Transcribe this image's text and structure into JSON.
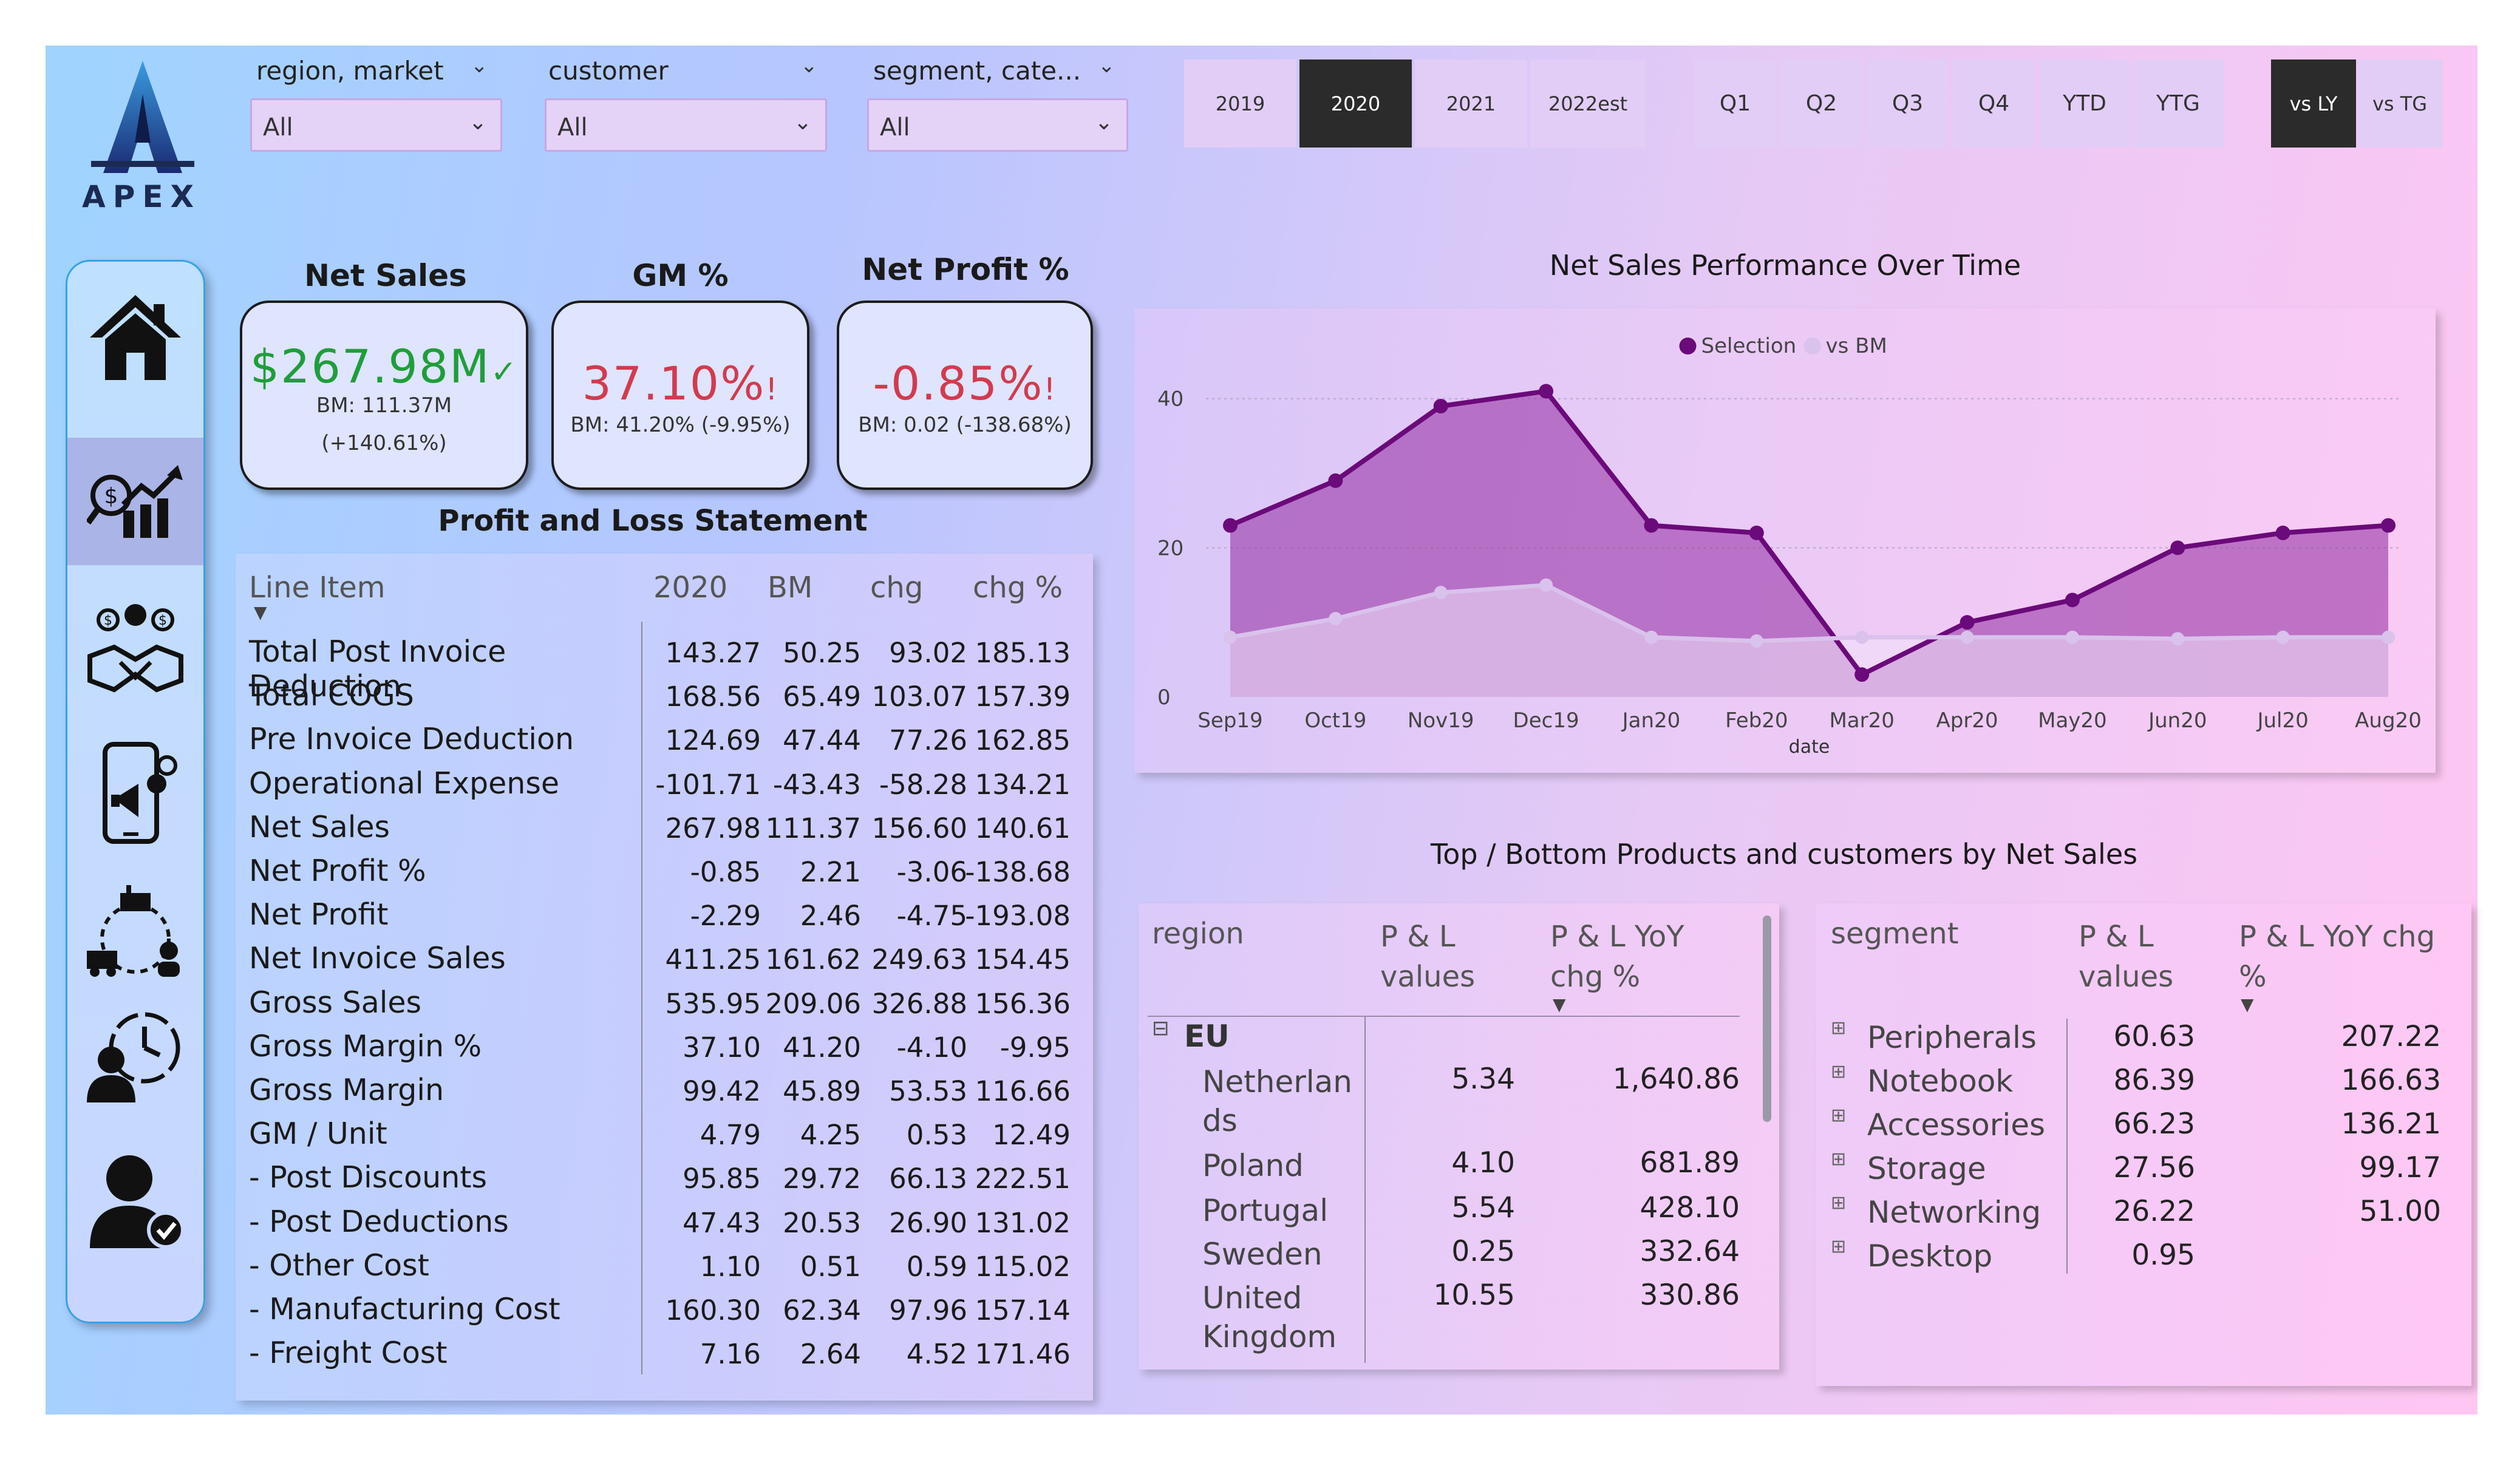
{
  "logo": {
    "text": "APEX"
  },
  "filters": [
    {
      "label": "region, market",
      "value": "All"
    },
    {
      "label": "customer",
      "value": "All"
    },
    {
      "label": "segment, cate...",
      "value": "All"
    }
  ],
  "years": [
    {
      "label": "2019",
      "active": false
    },
    {
      "label": "2020",
      "active": true
    },
    {
      "label": "2021",
      "active": false
    },
    {
      "label": "2022est",
      "active": false
    }
  ],
  "periods": [
    "Q1",
    "Q2",
    "Q3",
    "Q4",
    "YTD",
    "YTG"
  ],
  "compare": [
    {
      "label": "vs LY",
      "active": true
    },
    {
      "label": "vs TG",
      "active": false
    }
  ],
  "sidebar": {
    "items": [
      {
        "icon": "home-icon"
      },
      {
        "icon": "finance-chart-icon",
        "selected": true
      },
      {
        "icon": "sales-handshake-icon"
      },
      {
        "icon": "marketing-phone-icon"
      },
      {
        "icon": "supply-chain-icon"
      },
      {
        "icon": "time-person-icon"
      },
      {
        "icon": "user-check-icon"
      }
    ]
  },
  "kpis": {
    "net_sales": {
      "title": "Net Sales",
      "value": "$267.98M",
      "mark": "✓",
      "bm": "BM: 111.37M",
      "chg": "(+140.61%)",
      "color": "#1f9e3a"
    },
    "gm": {
      "title": "GM %",
      "value": "37.10%",
      "mark": "!",
      "bm": "BM: 41.20% (-9.95%)",
      "color": "#d23b4e"
    },
    "np": {
      "title": "Net Profit %",
      "value": "-0.85%",
      "mark": "!",
      "bm": "BM: 0.02 (-138.68%)",
      "color": "#d23b4e"
    }
  },
  "pl": {
    "title": "Profit and Loss Statement",
    "headers": [
      "Line Item",
      "2020",
      "BM",
      "chg",
      "chg %"
    ],
    "rows": [
      [
        "Total Post Invoice Deduction",
        "143.27",
        "50.25",
        "93.02",
        "185.13"
      ],
      [
        "Total COGS",
        "168.56",
        "65.49",
        "103.07",
        "157.39"
      ],
      [
        "Pre Invoice Deduction",
        "124.69",
        "47.44",
        "77.26",
        "162.85"
      ],
      [
        "Operational Expense",
        "-101.71",
        "-43.43",
        "-58.28",
        "134.21"
      ],
      [
        "Net Sales",
        "267.98",
        "111.37",
        "156.60",
        "140.61"
      ],
      [
        "Net Profit %",
        "-0.85",
        "2.21",
        "-3.06",
        "-138.68"
      ],
      [
        "Net Profit",
        "-2.29",
        "2.46",
        "-4.75",
        "-193.08"
      ],
      [
        "Net Invoice Sales",
        "411.25",
        "161.62",
        "249.63",
        "154.45"
      ],
      [
        "Gross Sales",
        "535.95",
        "209.06",
        "326.88",
        "156.36"
      ],
      [
        "Gross Margin %",
        "37.10",
        "41.20",
        "-4.10",
        "-9.95"
      ],
      [
        "Gross Margin",
        "99.42",
        "45.89",
        "53.53",
        "116.66"
      ],
      [
        "GM / Unit",
        "4.79",
        "4.25",
        "0.53",
        "12.49"
      ],
      [
        "- Post Discounts",
        "95.85",
        "29.72",
        "66.13",
        "222.51"
      ],
      [
        "- Post Deductions",
        "47.43",
        "20.53",
        "26.90",
        "131.02"
      ],
      [
        "- Other Cost",
        "1.10",
        "0.51",
        "0.59",
        "115.02"
      ],
      [
        "- Manufacturing Cost",
        "160.30",
        "62.34",
        "97.96",
        "157.14"
      ],
      [
        "- Freight Cost",
        "7.16",
        "2.64",
        "4.52",
        "171.46"
      ]
    ]
  },
  "chart_data": {
    "type": "area",
    "title": "Net Sales Performance Over Time",
    "xlabel": "date",
    "ylabel": "",
    "categories": [
      "Sep19",
      "Oct19",
      "Nov19",
      "Dec19",
      "Jan20",
      "Feb20",
      "Mar20",
      "Apr20",
      "May20",
      "Jun20",
      "Jul20",
      "Aug20"
    ],
    "series": [
      {
        "name": "Selection",
        "values": [
          23,
          29,
          39,
          41,
          23,
          22,
          3,
          10,
          13,
          20,
          22,
          23
        ],
        "color": "#6b0a7a"
      },
      {
        "name": "vs BM",
        "values": [
          8,
          10.5,
          14,
          15,
          8,
          7.5,
          8,
          8,
          8,
          7.8,
          8,
          8
        ],
        "color": "#d9c2ec"
      }
    ],
    "yticks": [
      "0",
      "20",
      "40"
    ],
    "ylim": [
      0,
      46
    ],
    "legend": "top-center"
  },
  "bottom": {
    "title": "Top / Bottom Products and customers by Net Sales",
    "region_table": {
      "headers": [
        "region",
        "P & L values",
        "P & L YoY chg %"
      ],
      "group": "EU",
      "rows": [
        [
          "Netherlan ds",
          "5.34",
          "1,640.86"
        ],
        [
          "Poland",
          "4.10",
          "681.89"
        ],
        [
          "Portugal",
          "5.54",
          "428.10"
        ],
        [
          "Sweden",
          "0.25",
          "332.64"
        ],
        [
          "United Kingdom",
          "10.55",
          "330.86"
        ]
      ]
    },
    "segment_table": {
      "headers": [
        "segment",
        "P & L values",
        "P & L YoY chg %"
      ],
      "rows": [
        [
          "Peripherals",
          "60.63",
          "207.22"
        ],
        [
          "Notebook",
          "86.39",
          "166.63"
        ],
        [
          "Accessories",
          "66.23",
          "136.21"
        ],
        [
          "Storage",
          "27.56",
          "99.17"
        ],
        [
          "Networking",
          "26.22",
          "51.00"
        ],
        [
          "Desktop",
          "0.95",
          ""
        ]
      ]
    }
  }
}
